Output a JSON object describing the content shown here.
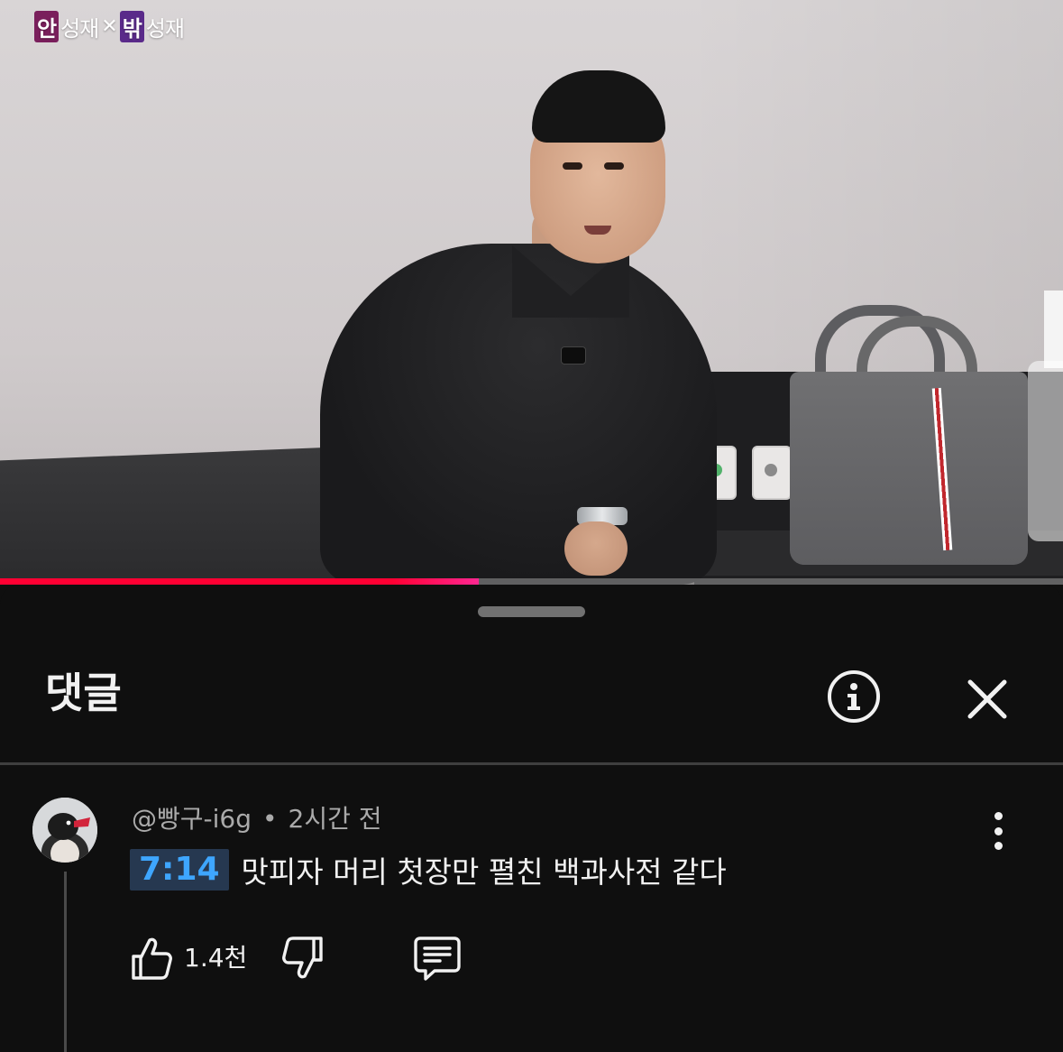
{
  "video": {
    "watermark": {
      "part1_box": "안",
      "part1_text": "성재",
      "separator": "✕",
      "part2_box": "밖",
      "part2_text": "성재"
    },
    "progress": 0.45,
    "progress_color": "#ff0033"
  },
  "comments_panel": {
    "title": "댓글",
    "info_icon": "info-icon",
    "close_icon": "close-icon"
  },
  "comment": {
    "author": "@빵구-i6g",
    "separator": "•",
    "time": "2시간 전",
    "timestamp_link": "7:14",
    "text": "맛피자 머리 첫장만 펼친 백과사전 같다",
    "likes": "1.4천",
    "icons": [
      "like-icon",
      "dislike-icon",
      "reply-icon",
      "more-vert-icon"
    ],
    "timestamp_color": "#3ea6ff"
  }
}
